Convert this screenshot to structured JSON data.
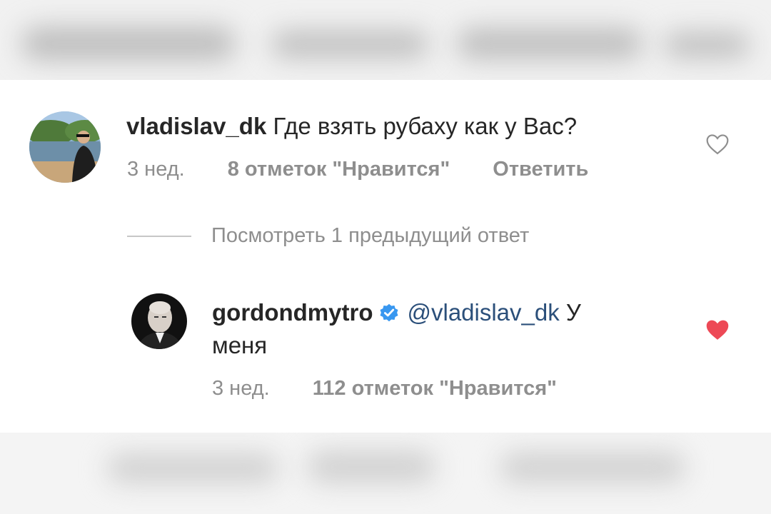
{
  "comment": {
    "username": "vladislav_dk",
    "text": "Где взять рубаху как у Вас?",
    "time": "3 нед.",
    "likes": "8 отметок \"Нравится\"",
    "reply": "Ответить",
    "liked": false
  },
  "view_replies": "Посмотреть 1 предыдущий ответ",
  "reply": {
    "username": "gordondmytro",
    "verified": true,
    "mention": "@vladislav_dk",
    "text_line1_end": "У",
    "text_line2": "меня",
    "time": "3 нед.",
    "likes": "112 отметок \"Нравится\"",
    "liked": true
  },
  "colors": {
    "heart_liked": "#ed4956",
    "verified_blue": "#3897f0",
    "mention": "#2b4f7a",
    "secondary_text": "#8e8e8e"
  },
  "icons": [
    "heart-outline-icon",
    "heart-filled-icon",
    "verified-badge-icon"
  ]
}
